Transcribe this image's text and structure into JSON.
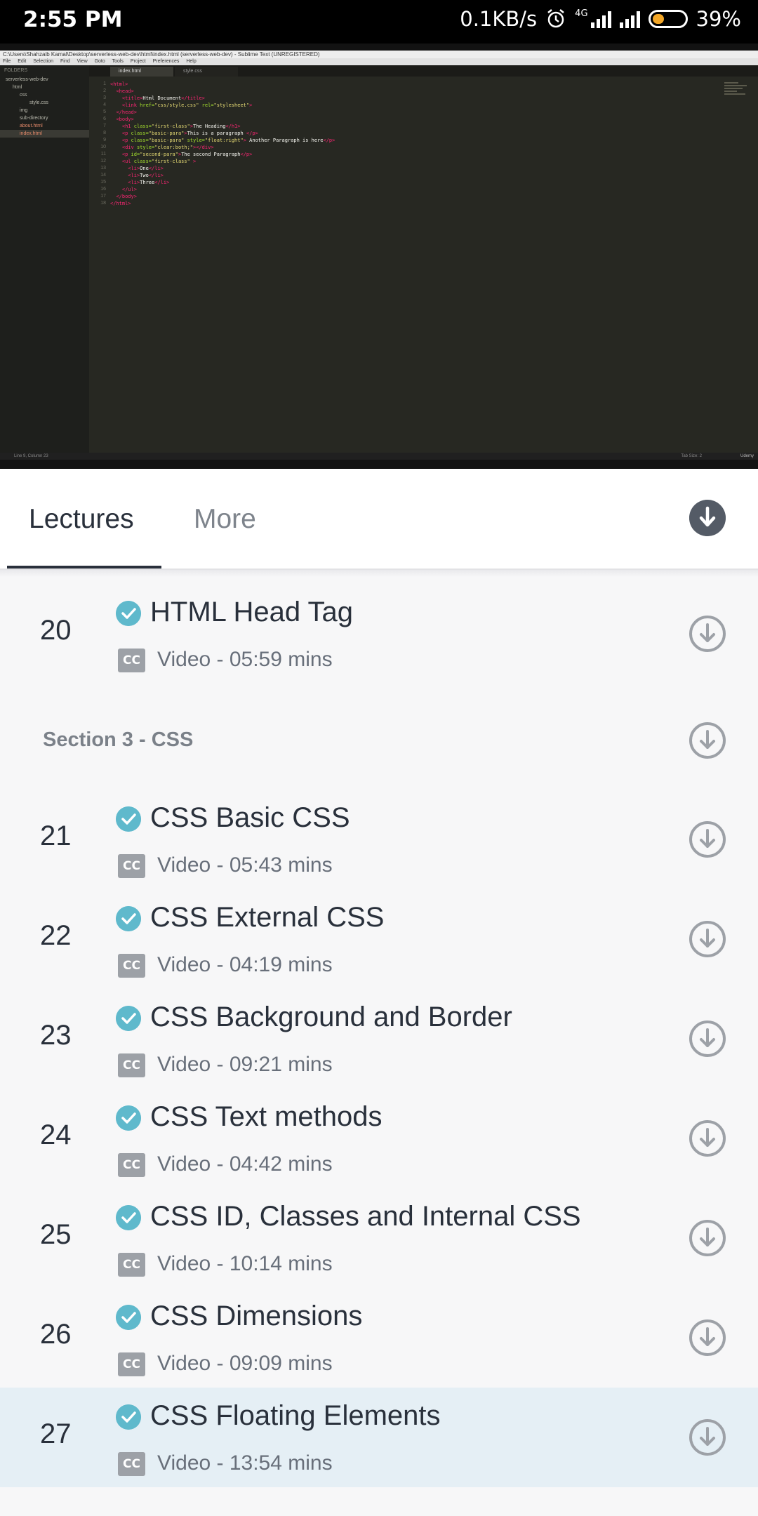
{
  "status_bar": {
    "time": "2:55 PM",
    "net_speed": "0.1KB/s",
    "net_type": "4G",
    "battery": "39%",
    "battery_level": 0.39,
    "icons": [
      "alarm-icon",
      "signal-icon",
      "signal-icon",
      "battery-icon"
    ]
  },
  "video": {
    "window_title": "C:\\Users\\Shahzaib Kamal\\Desktop\\serverless-web-dev\\html\\index.html (serverless-web-dev) - Sublime Text (UNREGISTERED)",
    "menu": [
      "File",
      "Edit",
      "Selection",
      "Find",
      "View",
      "Goto",
      "Tools",
      "Project",
      "Preferences",
      "Help"
    ],
    "folders_header": "FOLDERS",
    "tree": [
      "serverless-web-dev",
      "html",
      "css",
      "style.css",
      "img",
      "sub-directory",
      "about.html",
      "index.html"
    ],
    "tabs": [
      "index.html",
      "style.css"
    ],
    "line_numbers": "1\n2\n3\n4\n5\n6\n7\n8\n9\n10\n11\n12\n13\n14\n15\n16\n17\n18",
    "status_left": "Line 9, Column 23",
    "status_right": "Tab Size: 2",
    "watermark": "Udemy"
  },
  "tabs": {
    "lectures": "Lectures",
    "more": "More"
  },
  "lectures": [
    {
      "num": "20",
      "title": "HTML Head Tag",
      "meta": "Video - 05:59 mins"
    },
    {
      "section": "Section 3 - CSS"
    },
    {
      "num": "21",
      "title": "CSS Basic CSS",
      "meta": "Video - 05:43 mins"
    },
    {
      "num": "22",
      "title": "CSS External CSS",
      "meta": "Video - 04:19 mins"
    },
    {
      "num": "23",
      "title": "CSS Background and Border",
      "meta": "Video - 09:21 mins"
    },
    {
      "num": "24",
      "title": "CSS Text methods",
      "meta": "Video - 04:42 mins"
    },
    {
      "num": "25",
      "title": "CSS ID, Classes and Internal CSS",
      "meta": "Video - 10:14 mins"
    },
    {
      "num": "26",
      "title": "CSS Dimensions",
      "meta": "Video - 09:09 mins"
    },
    {
      "num": "27",
      "title": "CSS Floating Elements",
      "meta": "Video - 13:54 mins",
      "current": true
    }
  ],
  "cc_label": "CC",
  "colors": {
    "check": "#5fb9cc",
    "highlight": "#e5eff5",
    "text": "#29303b",
    "meta": "#686f7a",
    "download": "#9da1a7"
  }
}
